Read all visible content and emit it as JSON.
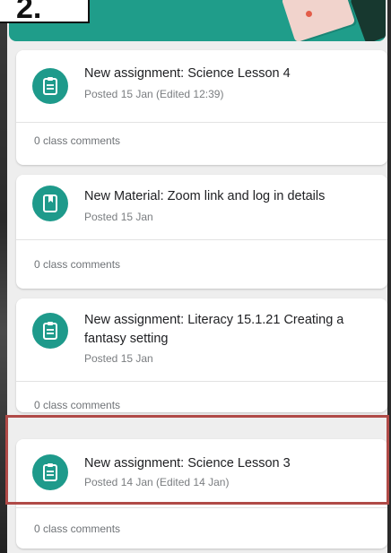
{
  "step_label": "2.",
  "posts": [
    {
      "title": "New assignment: Science Lesson 4",
      "meta": "Posted 15 Jan (Edited 12:39)",
      "comments": "0 class comments",
      "icon": "assignment-icon"
    },
    {
      "title": "New Material: Zoom link and log in details",
      "meta": "Posted 15 Jan",
      "comments": "0 class comments",
      "icon": "material-icon"
    },
    {
      "title": "New assignment: Literacy 15.1.21 Creating a fantasy setting",
      "meta": "Posted 15 Jan",
      "comments": "0 class comments",
      "icon": "assignment-icon"
    },
    {
      "title": "New assignment: Science Lesson 3",
      "meta": "Posted 14 Jan (Edited 14 Jan)",
      "comments": "0 class comments",
      "icon": "assignment-icon"
    }
  ],
  "colors": {
    "teal": "#1e9a8b",
    "highlight": "#b04a47"
  }
}
